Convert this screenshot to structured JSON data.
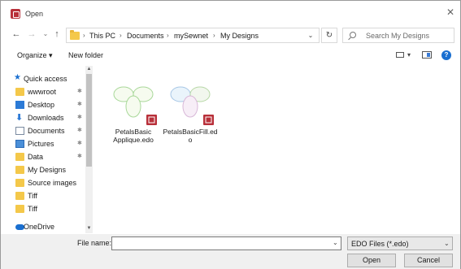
{
  "window": {
    "title": "Open",
    "close_glyph": "✕",
    "app_icon": "mysewnet-app-icon"
  },
  "nav": {
    "back": "←",
    "forward": "→",
    "recent": "⌄",
    "up": "↑",
    "breadcrumb": [
      "This PC",
      "Documents",
      "mySewnet",
      "My Designs"
    ],
    "breadcrumb_sep": "›",
    "address_dropdown": "⌄",
    "refresh": "↻",
    "search_placeholder": "Search My Designs"
  },
  "toolbar": {
    "organize": "Organize ▾",
    "new_folder": "New folder",
    "view_dropdown": "▾",
    "help": "?"
  },
  "sidebar": {
    "items": [
      {
        "label": "Quick access",
        "icon": "star-icon",
        "pinned": false
      },
      {
        "label": "wwwroot",
        "icon": "folder-icon",
        "pinned": true
      },
      {
        "label": "Desktop",
        "icon": "desktop-icon",
        "pinned": true
      },
      {
        "label": "Downloads",
        "icon": "download-icon",
        "pinned": true
      },
      {
        "label": "Documents",
        "icon": "documents-icon",
        "pinned": true
      },
      {
        "label": "Pictures",
        "icon": "pictures-icon",
        "pinned": true
      },
      {
        "label": "Data",
        "icon": "folder-icon",
        "pinned": true
      },
      {
        "label": "My Designs",
        "icon": "folder-icon",
        "pinned": false
      },
      {
        "label": "Source images",
        "icon": "folder-icon",
        "pinned": false
      },
      {
        "label": "Tiff",
        "icon": "folder-icon",
        "pinned": false
      },
      {
        "label": "Tiff",
        "icon": "folder-icon",
        "pinned": false
      },
      {
        "label": "OneDrive",
        "icon": "cloud-icon",
        "pinned": false
      }
    ],
    "pin_glyph": "📌"
  },
  "files": [
    {
      "name": "PetalsBasicApplique.edo",
      "label_lines": [
        "PetalsBasic",
        "Applique.edo"
      ]
    },
    {
      "name": "PetalsBasicFill.edo",
      "label_lines": [
        "PetalsBasicFill.ed",
        "o"
      ]
    }
  ],
  "bottom": {
    "file_name_label": "File name:",
    "file_name_value": "",
    "filter": "EDO Files (*.edo)",
    "open": "Open",
    "cancel": "Cancel"
  },
  "colors": {
    "accent": "#1a6fd0",
    "folder": "#f4c84a",
    "brand": "#b8303a"
  }
}
